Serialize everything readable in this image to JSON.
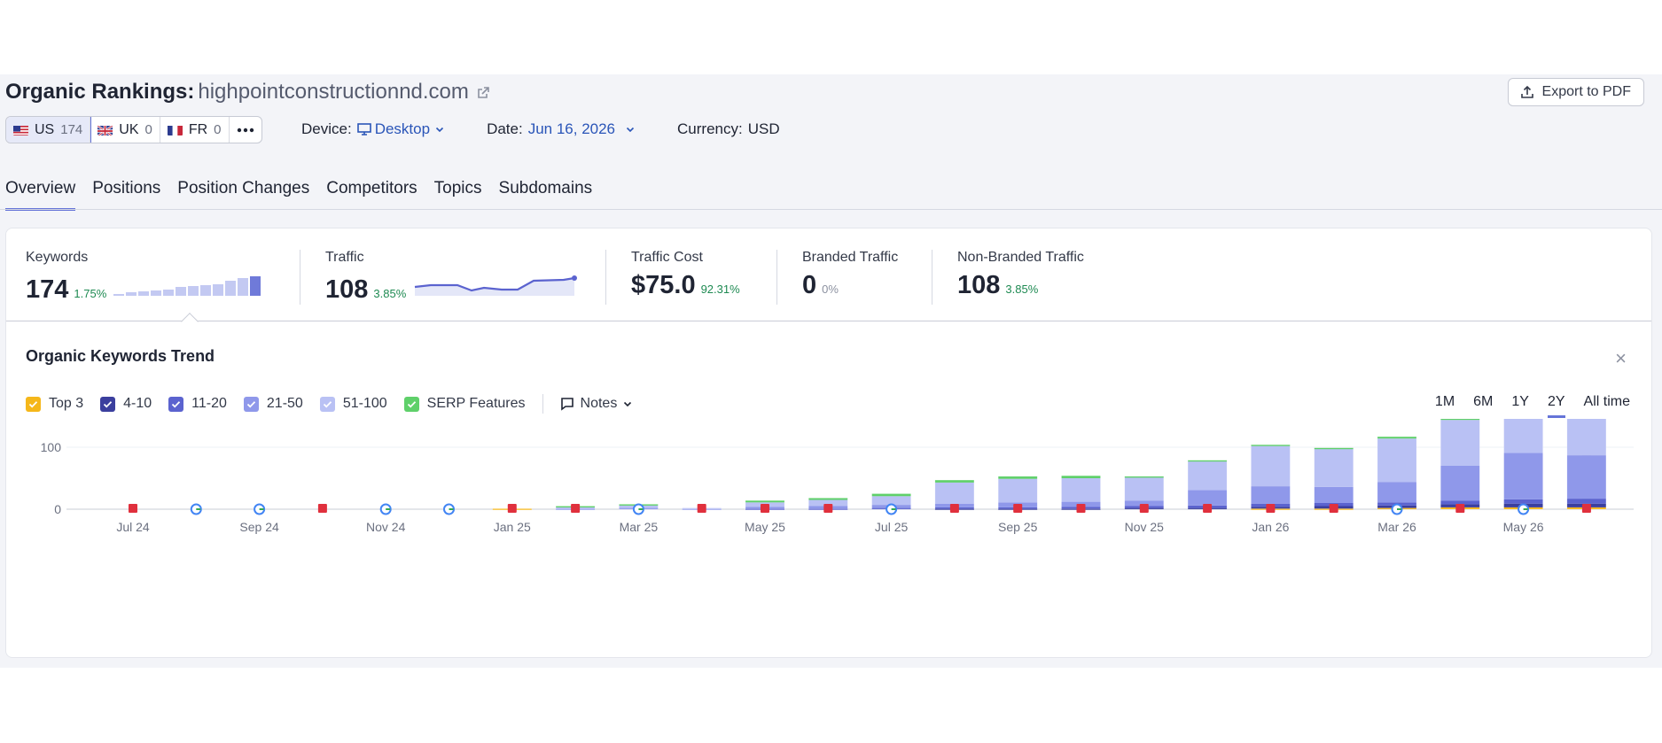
{
  "header": {
    "title": "Organic Rankings:",
    "domain": "highpointconstructionnd.com",
    "export_label": "Export to PDF"
  },
  "databases": [
    {
      "code": "US",
      "count": "174",
      "active": true
    },
    {
      "code": "UK",
      "count": "0",
      "active": false
    },
    {
      "code": "FR",
      "count": "0",
      "active": false
    }
  ],
  "filters": {
    "device_label": "Device:",
    "device_value": "Desktop",
    "date_label": "Date:",
    "date_value": "Jun 16, 2026",
    "currency_label": "Currency:",
    "currency_value": "USD"
  },
  "tabs": [
    "Overview",
    "Positions",
    "Position Changes",
    "Competitors",
    "Topics",
    "Subdomains"
  ],
  "metrics": {
    "keywords": {
      "label": "Keywords",
      "value": "174",
      "change": "1.75%"
    },
    "traffic": {
      "label": "Traffic",
      "value": "108",
      "change": "3.85%"
    },
    "traffic_cost": {
      "label": "Traffic Cost",
      "value": "$75.0",
      "change": "92.31%"
    },
    "branded": {
      "label": "Branded Traffic",
      "value": "0",
      "change": "0%"
    },
    "non_branded": {
      "label": "Non-Branded Traffic",
      "value": "108",
      "change": "3.85%"
    }
  },
  "trend": {
    "title": "Organic Keywords Trend",
    "legend": [
      {
        "label": "Top 3",
        "color": "#f5b71a"
      },
      {
        "label": "4-10",
        "color": "#3b3f9e"
      },
      {
        "label": "11-20",
        "color": "#5b63cf"
      },
      {
        "label": "21-50",
        "color": "#8f98ea"
      },
      {
        "label": "51-100",
        "color": "#b9c1f4"
      },
      {
        "label": "SERP Features",
        "color": "#5fd06a"
      }
    ],
    "notes_label": "Notes",
    "ranges": [
      "1M",
      "6M",
      "1Y",
      "2Y",
      "All time"
    ],
    "active_range": "2Y"
  },
  "colors": {
    "accent": "#6574d8",
    "positive": "#1e8a52",
    "link": "#2a55b8"
  },
  "chart_data": {
    "type": "bar",
    "stacked": true,
    "yticks": [
      0,
      100,
      200
    ],
    "ylim": [
      0,
      250
    ],
    "x_tick_labels": [
      "Jul 24",
      "Sep 24",
      "Nov 24",
      "Jan 25",
      "Mar 25",
      "May 25",
      "Jul 25",
      "Sep 25",
      "Nov 25",
      "Jan 26",
      "Mar 26",
      "May 26"
    ],
    "categories": [
      "Jul 24",
      "Aug 24",
      "Sep 24",
      "Oct 24",
      "Nov 24",
      "Dec 24",
      "Jan 25",
      "Feb 25",
      "Mar 25",
      "Apr 25",
      "May 25",
      "Jun 25",
      "Jul 25",
      "Aug 25",
      "Sep 25",
      "Oct 25",
      "Nov 25",
      "Dec 25",
      "Jan 26",
      "Feb 26",
      "Mar 26",
      "Apr 26",
      "May 26",
      "Jun 26"
    ],
    "series": [
      {
        "name": "Top 3",
        "color": "#f5b71a",
        "values": [
          0,
          0,
          0,
          0,
          0,
          0,
          1,
          0,
          0,
          0,
          0,
          0,
          0,
          0,
          0,
          0,
          0,
          0,
          1,
          1,
          2,
          3,
          3,
          3
        ]
      },
      {
        "name": "4-10",
        "color": "#3b3f9e",
        "values": [
          0,
          0,
          0,
          0,
          0,
          0,
          0,
          0,
          0,
          0,
          0,
          0,
          0,
          1,
          1,
          1,
          2,
          2,
          3,
          4,
          4,
          5,
          6,
          6
        ]
      },
      {
        "name": "11-20",
        "color": "#5b63cf",
        "values": [
          0,
          0,
          0,
          0,
          0,
          0,
          0,
          0,
          0,
          0,
          1,
          1,
          2,
          2,
          2,
          3,
          3,
          4,
          5,
          5,
          5,
          6,
          7,
          8
        ]
      },
      {
        "name": "21-50",
        "color": "#8f98ea",
        "values": [
          0,
          0,
          0,
          0,
          0,
          0,
          0,
          1,
          2,
          1,
          3,
          4,
          5,
          6,
          8,
          8,
          9,
          25,
          28,
          26,
          33,
          56,
          75,
          70
        ]
      },
      {
        "name": "51-100",
        "color": "#b9c1f4",
        "values": [
          0,
          0,
          0,
          0,
          0,
          0,
          0,
          3,
          4,
          1,
          7,
          10,
          14,
          34,
          38,
          38,
          38,
          46,
          65,
          62,
          70,
          74,
          76,
          83
        ]
      },
      {
        "name": "SERP Features",
        "color": "#5fd06a",
        "values": [
          0,
          0,
          0,
          0,
          0,
          0,
          0,
          1,
          2,
          0,
          3,
          3,
          4,
          4,
          4,
          4,
          1,
          2,
          2,
          1,
          3,
          3,
          4,
          4
        ]
      }
    ],
    "markers": [
      "flag",
      "google",
      "google",
      "flag",
      "google",
      "google",
      "flag",
      "flag",
      "google",
      "flag",
      "flag",
      "flag",
      "google",
      "flag",
      "flag",
      "flag",
      "flag",
      "flag",
      "flag",
      "flag",
      "google",
      "flag",
      "google",
      "flag"
    ]
  }
}
